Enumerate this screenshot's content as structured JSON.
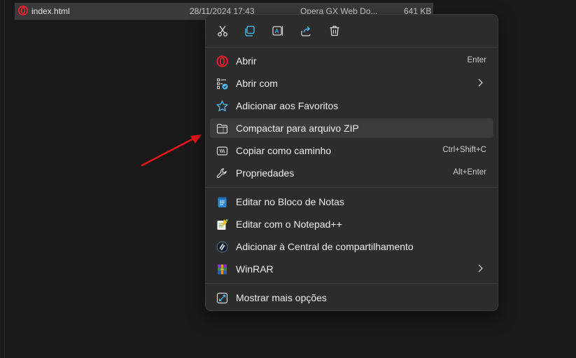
{
  "file": {
    "name": "index.html",
    "date": "28/11/2024 17:43",
    "type": "Opera GX Web Do...",
    "size": "641 KB"
  },
  "toolbar": {
    "cut": "cut-icon",
    "copy": "copy-icon",
    "rename": "rename-icon",
    "share": "share-icon",
    "delete": "delete-icon"
  },
  "menu": {
    "open": {
      "label": "Abrir",
      "shortcut": "Enter"
    },
    "open_with": {
      "label": "Abrir com"
    },
    "add_favorites": {
      "label": "Adicionar aos Favoritos"
    },
    "compress_zip": {
      "label": "Compactar para arquivo ZIP"
    },
    "copy_path": {
      "label": "Copiar como caminho",
      "shortcut": "Ctrl+Shift+C"
    },
    "properties": {
      "label": "Propriedades",
      "shortcut": "Alt+Enter"
    },
    "edit_notepad": {
      "label": "Editar no Bloco de Notas"
    },
    "edit_notepadpp": {
      "label": "Editar com o Notepad++"
    },
    "add_sharing": {
      "label": "Adicionar à Central de compartilhamento"
    },
    "winrar": {
      "label": "WinRAR"
    },
    "more_options": {
      "label": "Mostrar mais opções"
    }
  },
  "colors": {
    "menu_bg": "#2c2c2c",
    "highlight": "#3b3b3b",
    "accent_blue": "#4cc2ff",
    "opera_red": "#ff1b2d",
    "annotation_arrow": "#e0161b"
  }
}
